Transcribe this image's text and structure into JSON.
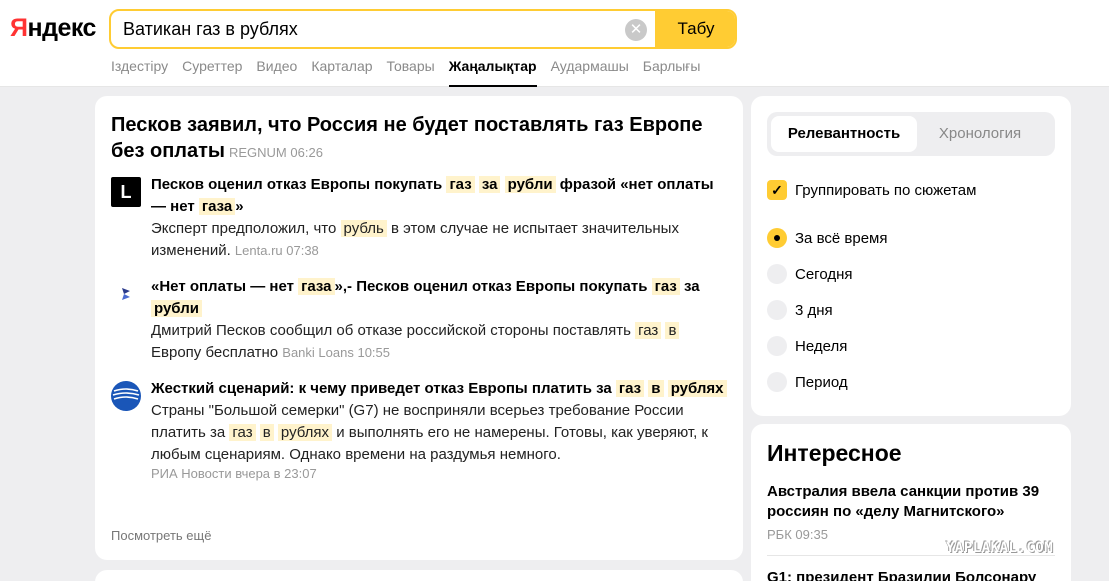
{
  "logo": {
    "part1": "Я",
    "part2": "ндекс"
  },
  "search": {
    "value": "Ватикан газ в рублях",
    "clear_label": "✕",
    "button_label": "Табу"
  },
  "tabs": [
    "Іздестіру",
    "Суреттер",
    "Видео",
    "Карталар",
    "Товары",
    "Жаңалықтар",
    "Аудармашы",
    "Барлығы"
  ],
  "active_tab": "Жаңалықтар",
  "story": {
    "title": "Песков заявил, что Россия не будет поставлять газ Европе без оплаты",
    "source": "REGNUM",
    "time": "06:26",
    "items": [
      {
        "logo": "L",
        "title_parts": [
          "Песков оценил отказ Европы покупать ",
          "газ",
          " ",
          "за",
          " ",
          "рубли",
          " фразой «нет оплаты — нет ",
          "газа",
          "»"
        ],
        "text_parts": [
          "Эксперт предположил, что ",
          "рубль",
          " в этом случае не испытает значительных изменений."
        ],
        "source": "Lenta.ru",
        "time": "07:38"
      },
      {
        "title_parts": [
          "«Нет оплаты — нет ",
          "газа",
          "»,- Песков оценил отказ Европы покупать ",
          "газ",
          " за ",
          "рубли"
        ],
        "text_parts": [
          "Дмитрий Песков сообщил об отказе российской стороны поставлять ",
          "газ",
          " ",
          "в",
          " Европу бесплатно"
        ],
        "source": "Banki Loans",
        "time": "10:55"
      },
      {
        "title_parts": [
          "Жесткий сценарий: к чему приведет отказ Европы платить за ",
          "газ",
          " ",
          "в",
          " ",
          "рублях"
        ],
        "text_parts": [
          "Страны \"Большой семерки\" (G7) не восприняли всерьез требование России платить за ",
          "газ",
          " ",
          "в",
          " ",
          "рублях",
          " и выполнять его не намерены. Готовы, как уверяют, к любым сценариям. Однако времени на раздумья немного."
        ],
        "source": "РИА Новости",
        "time": "вчера в 23:07"
      }
    ],
    "more_label": "Посмотреть ещё"
  },
  "filters": {
    "sort_relevance": "Релевантность",
    "sort_chrono": "Хронология",
    "group_label": "Группировать по сюжетам",
    "periods": [
      "За всё время",
      "Сегодня",
      "3 дня",
      "Неделя",
      "Период"
    ]
  },
  "interesting": {
    "title": "Интересное",
    "item1_title": "Австралия ввела санкции против 39 россиян по «делу Магнитского»",
    "item1_source": "РБК",
    "item1_time": "09:35",
    "item2_title": "G1: президент Бразилии Болсонару"
  },
  "watermark": "YAPLAKAL.COM"
}
